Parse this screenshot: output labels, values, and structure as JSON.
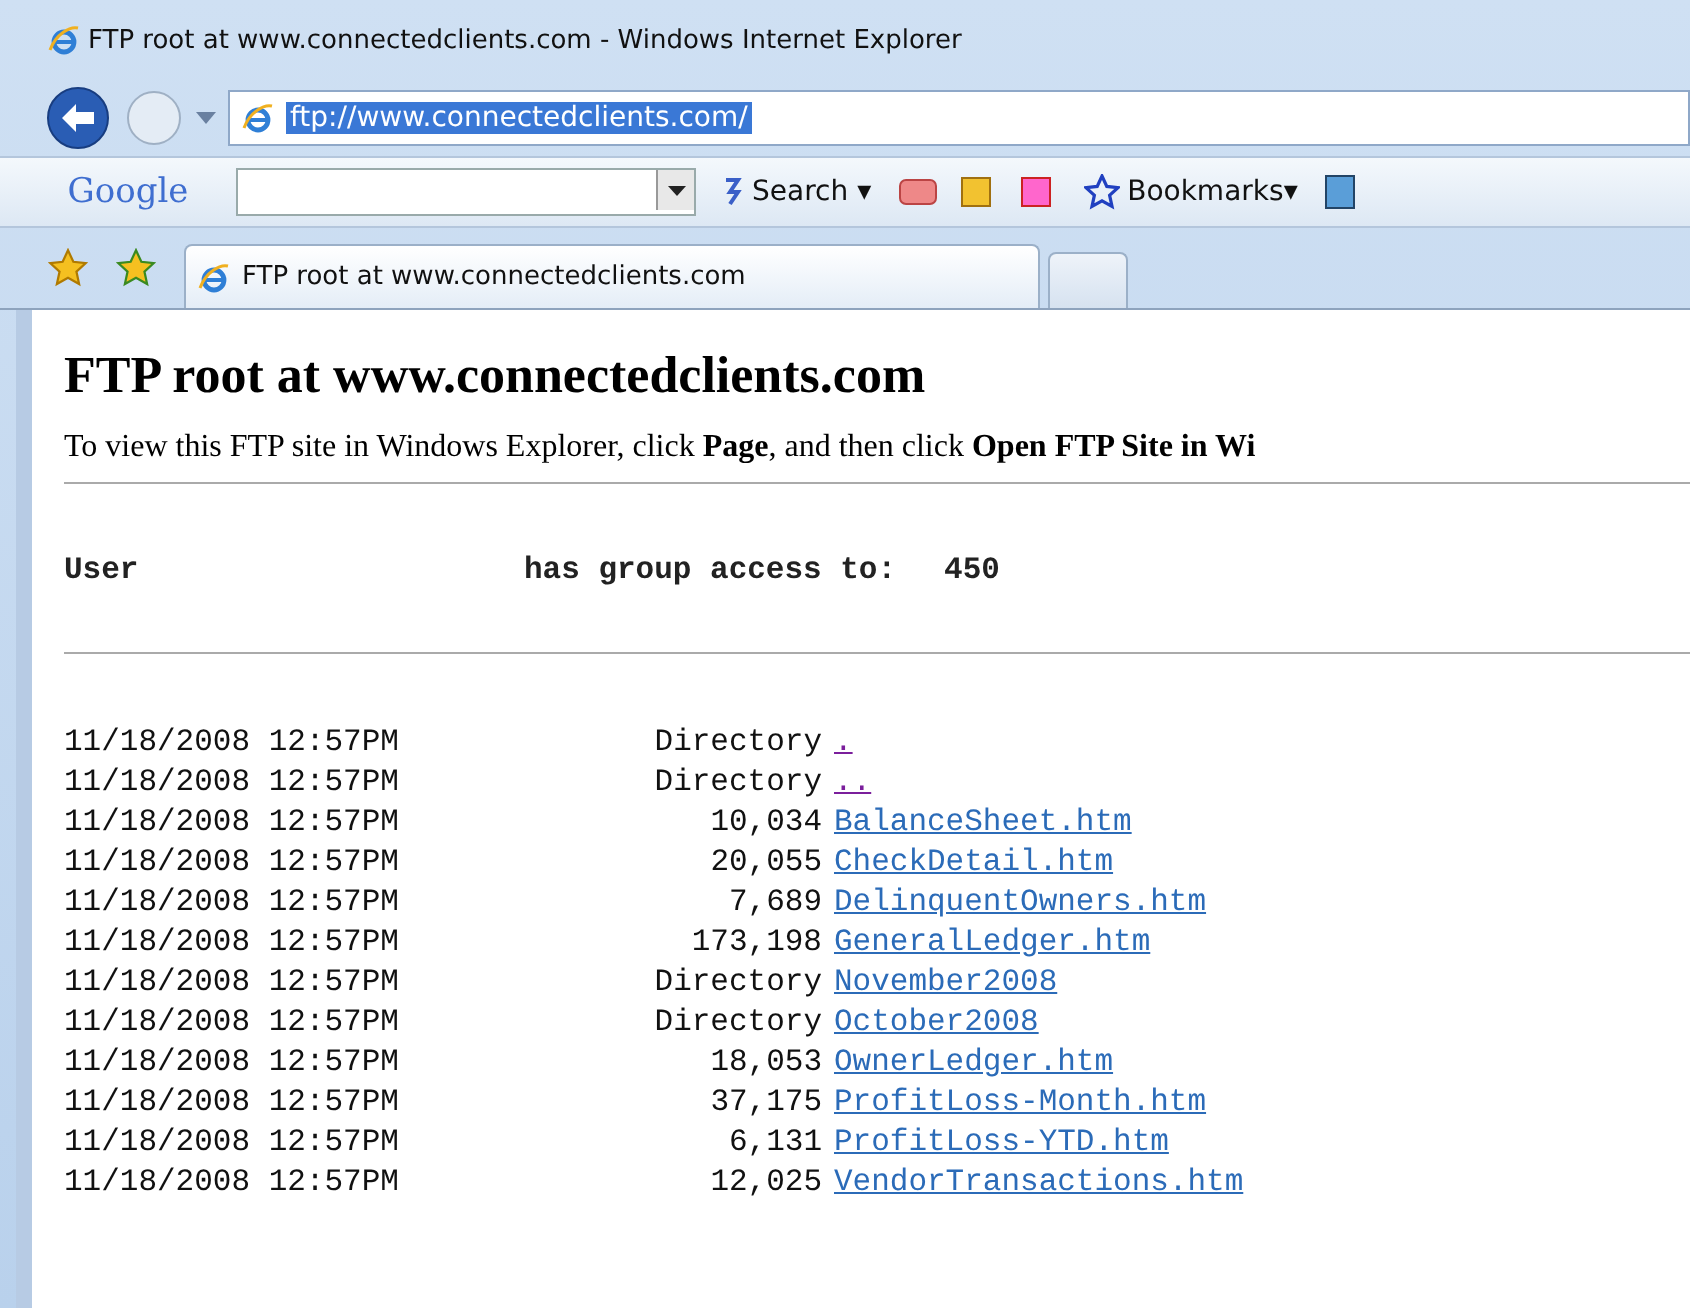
{
  "window": {
    "title": "FTP root at www.connectedclients.com - Windows Internet Explorer"
  },
  "address_bar": {
    "value": "ftp://www.connectedclients.com/"
  },
  "google_toolbar": {
    "brand": "Google",
    "search_label": "Search",
    "search_caret": "▾",
    "bookmarks_label": "Bookmarks",
    "bookmarks_caret": "▾"
  },
  "tabs": [
    {
      "label": "FTP root at www.connectedclients.com",
      "selected": true
    },
    {
      "selected": false
    }
  ],
  "page": {
    "heading": "FTP root at www.connectedclients.com",
    "intro": "To view this FTP site in Windows Explorer, click **Page**, and then click **Open FTP Site in Wi**",
    "access": {
      "user_label": "User",
      "access_label": "has group access to:",
      "group": "450"
    },
    "files": [
      {
        "date": "11/18/2008 12:57PM",
        "size": "Directory",
        "name": ".",
        "visited": true
      },
      {
        "date": "11/18/2008 12:57PM",
        "size": "Directory",
        "name": "..",
        "visited": true
      },
      {
        "date": "11/18/2008 12:57PM",
        "size": "10,034",
        "name": "BalanceSheet.htm",
        "visited": false
      },
      {
        "date": "11/18/2008 12:57PM",
        "size": "20,055",
        "name": "CheckDetail.htm",
        "visited": false
      },
      {
        "date": "11/18/2008 12:57PM",
        "size": "7,689",
        "name": "DelinquentOwners.htm",
        "visited": false
      },
      {
        "date": "11/18/2008 12:57PM",
        "size": "173,198",
        "name": "GeneralLedger.htm",
        "visited": false
      },
      {
        "date": "11/18/2008 12:57PM",
        "size": "Directory",
        "name": "November2008",
        "visited": false
      },
      {
        "date": "11/18/2008 12:57PM",
        "size": "Directory",
        "name": "October2008",
        "visited": false
      },
      {
        "date": "11/18/2008 12:57PM",
        "size": "18,053",
        "name": "OwnerLedger.htm",
        "visited": false
      },
      {
        "date": "11/18/2008 12:57PM",
        "size": "37,175",
        "name": "ProfitLoss-Month.htm",
        "visited": false
      },
      {
        "date": "11/18/2008 12:57PM",
        "size": "6,131",
        "name": "ProfitLoss-YTD.htm",
        "visited": false
      },
      {
        "date": "11/18/2008 12:57PM",
        "size": "12,025",
        "name": "VendorTransactions.htm",
        "visited": false
      }
    ]
  }
}
